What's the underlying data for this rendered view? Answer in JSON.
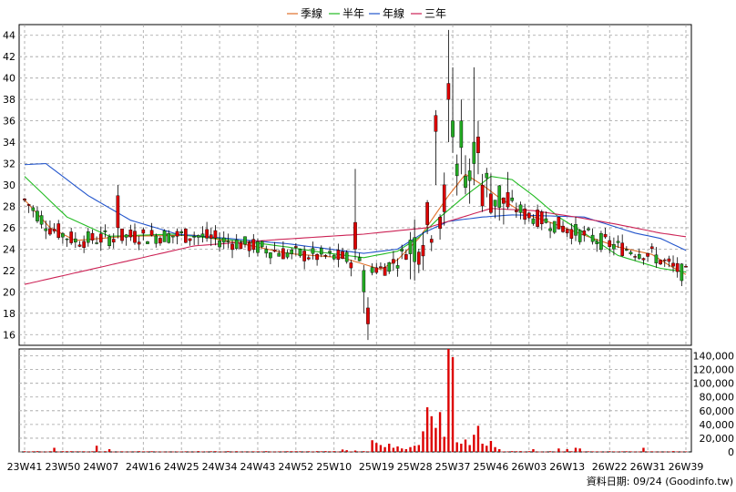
{
  "chart_data": {
    "type": "candlestick",
    "legend": [
      {
        "name": "季線",
        "color": "#e0702a"
      },
      {
        "name": "半年",
        "color": "#22bb22"
      },
      {
        "name": "年線",
        "color": "#2255cc"
      },
      {
        "name": "三年",
        "color": "#cc2255"
      }
    ],
    "price_axis": {
      "ylim": [
        15,
        45
      ],
      "ticks": [
        16,
        18,
        20,
        22,
        24,
        26,
        28,
        30,
        32,
        34,
        36,
        38,
        40,
        42,
        44
      ]
    },
    "volume_axis": {
      "ylim": [
        0,
        150000
      ],
      "ticks": [
        "0",
        "20,000",
        "40,000",
        "60,000",
        "80,000",
        "100,000",
        "120,000",
        "140,000"
      ],
      "tick_values": [
        0,
        20000,
        40000,
        60000,
        80000,
        100000,
        120000,
        140000
      ]
    },
    "x_ticks": [
      "23W41",
      "23W50",
      "24W07",
      "24W16",
      "24W25",
      "24W34",
      "24W43",
      "24W52",
      "25W10",
      "25W19",
      "25W28",
      "25W37",
      "25W46",
      "26W03",
      "26W13",
      "26W22",
      "26W31",
      "26W39"
    ],
    "candle_count": 157,
    "source": "資料日期: 09/24 (Goodinfo.tw)",
    "colors": {
      "up": "#dd0000",
      "down": "#22aa22",
      "grid": "#a0a0a0",
      "wick": "#000000"
    },
    "ma_series": {
      "季線": [
        [
          0,
          28.6
        ],
        [
          6,
          26
        ],
        [
          12,
          24.8
        ],
        [
          24,
          25.2
        ],
        [
          40,
          25.3
        ],
        [
          50,
          24.6
        ],
        [
          62,
          23.6
        ],
        [
          68,
          23.4
        ],
        [
          75,
          23.2
        ],
        [
          84,
          22.1
        ],
        [
          88,
          23
        ],
        [
          93,
          25
        ],
        [
          100,
          29
        ],
        [
          104,
          31
        ],
        [
          108,
          30
        ],
        [
          112,
          28.8
        ],
        [
          118,
          27.3
        ],
        [
          124,
          26.5
        ],
        [
          132,
          25.3
        ],
        [
          140,
          24.2
        ],
        [
          148,
          23.5
        ],
        [
          152,
          22.5
        ],
        [
          157,
          21.4
        ]
      ],
      "半年": [
        [
          0,
          30.8
        ],
        [
          10,
          27
        ],
        [
          20,
          25.2
        ],
        [
          35,
          25.4
        ],
        [
          50,
          24.8
        ],
        [
          62,
          24.2
        ],
        [
          70,
          23.7
        ],
        [
          80,
          23.2
        ],
        [
          88,
          23.8
        ],
        [
          93,
          25.1
        ],
        [
          98,
          27
        ],
        [
          104,
          29
        ],
        [
          110,
          30.8
        ],
        [
          115,
          30.5
        ],
        [
          120,
          29
        ],
        [
          126,
          27
        ],
        [
          132,
          25.5
        ],
        [
          140,
          23.4
        ],
        [
          150,
          22.2
        ],
        [
          157,
          21.8
        ]
      ],
      "年線": [
        [
          0,
          31.9
        ],
        [
          5,
          32
        ],
        [
          15,
          29
        ],
        [
          25,
          26.7
        ],
        [
          36,
          25.4
        ],
        [
          48,
          25
        ],
        [
          62,
          24.5
        ],
        [
          72,
          24
        ],
        [
          80,
          23.6
        ],
        [
          88,
          24
        ],
        [
          94,
          25.5
        ],
        [
          100,
          26.6
        ],
        [
          108,
          27
        ],
        [
          115,
          27.2
        ],
        [
          124,
          27.1
        ],
        [
          132,
          27
        ],
        [
          144,
          25.5
        ],
        [
          150,
          25
        ],
        [
          157,
          23.7
        ]
      ],
      "三年": [
        [
          0,
          20.7
        ],
        [
          20,
          22.5
        ],
        [
          40,
          24.3
        ],
        [
          60,
          24.9
        ],
        [
          80,
          25.4
        ],
        [
          95,
          26
        ],
        [
          110,
          27.8
        ],
        [
          120,
          27.6
        ],
        [
          130,
          27
        ],
        [
          140,
          26.3
        ],
        [
          150,
          25.5
        ],
        [
          157,
          25.1
        ]
      ]
    },
    "volume_spikes": [
      {
        "i": 7,
        "v": 6000
      },
      {
        "i": 17,
        "v": 9000
      },
      {
        "i": 20,
        "v": 4000
      },
      {
        "i": 75,
        "v": 3500
      },
      {
        "i": 76,
        "v": 2500
      },
      {
        "i": 78,
        "v": 2000
      },
      {
        "i": 82,
        "v": 17000
      },
      {
        "i": 83,
        "v": 13000
      },
      {
        "i": 84,
        "v": 10000
      },
      {
        "i": 85,
        "v": 7000
      },
      {
        "i": 86,
        "v": 12000
      },
      {
        "i": 87,
        "v": 6000
      },
      {
        "i": 88,
        "v": 8000
      },
      {
        "i": 89,
        "v": 5000
      },
      {
        "i": 90,
        "v": 4000
      },
      {
        "i": 91,
        "v": 7000
      },
      {
        "i": 92,
        "v": 9000
      },
      {
        "i": 93,
        "v": 10000
      },
      {
        "i": 94,
        "v": 30000
      },
      {
        "i": 95,
        "v": 65000
      },
      {
        "i": 96,
        "v": 52000
      },
      {
        "i": 97,
        "v": 35000
      },
      {
        "i": 98,
        "v": 58000
      },
      {
        "i": 99,
        "v": 22000
      },
      {
        "i": 100,
        "v": 158000
      },
      {
        "i": 101,
        "v": 138000
      },
      {
        "i": 102,
        "v": 14000
      },
      {
        "i": 103,
        "v": 12000
      },
      {
        "i": 104,
        "v": 18000
      },
      {
        "i": 105,
        "v": 10000
      },
      {
        "i": 106,
        "v": 25000
      },
      {
        "i": 107,
        "v": 38000
      },
      {
        "i": 108,
        "v": 12000
      },
      {
        "i": 109,
        "v": 9000
      },
      {
        "i": 110,
        "v": 16000
      },
      {
        "i": 111,
        "v": 7000
      },
      {
        "i": 112,
        "v": 4000
      },
      {
        "i": 120,
        "v": 4000
      },
      {
        "i": 126,
        "v": 5000
      },
      {
        "i": 128,
        "v": 4000
      },
      {
        "i": 130,
        "v": 6000
      },
      {
        "i": 131,
        "v": 5000
      },
      {
        "i": 146,
        "v": 6000
      }
    ]
  }
}
